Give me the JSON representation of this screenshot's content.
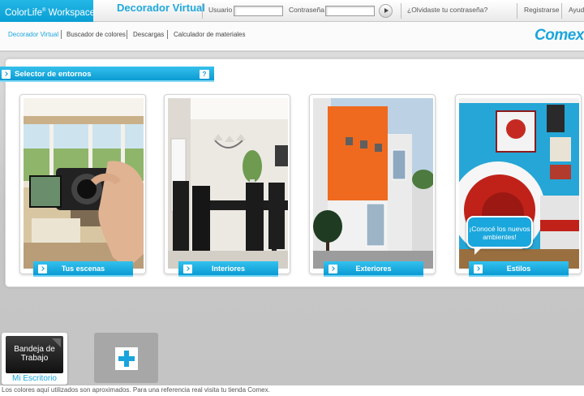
{
  "header": {
    "brand": "ColorLife",
    "brand_mark": "®",
    "brand_suffix": "Workspace",
    "app_title": "Decorador Virtual",
    "user_label": "Usuario",
    "password_label": "Contraseña",
    "forgot_password": "¿Olvidaste tu contraseña?",
    "register": "Registrarse",
    "help": "Ayuda",
    "accent": "#1ca6dc"
  },
  "nav": {
    "items": [
      {
        "label": "Decorador Virtual",
        "active": true
      },
      {
        "label": "Buscador de colores"
      },
      {
        "label": "Descargas"
      },
      {
        "label": "Calculador de materiales"
      }
    ],
    "logo": "Comex"
  },
  "selector": {
    "title": "Selector de entornos",
    "help": "?",
    "cards": [
      {
        "label": "Tus escenas",
        "icon": "camera-scene"
      },
      {
        "label": "Interiores",
        "icon": "dining-room-scene"
      },
      {
        "label": "Exteriores",
        "icon": "house-exterior-scene"
      },
      {
        "label": "Estilos",
        "icon": "styled-room-scene"
      }
    ],
    "bubble": "¡Conocé los nuevos ambientes!"
  },
  "workspace": {
    "tile_title": "Bandeja de Trabajo",
    "tile_label": "Mi Escritorio",
    "add_icon": "plus-icon"
  },
  "disclaimer": "Los colores aquí utilizados son aproximados. Para una referencia real visita tu tienda Comex."
}
